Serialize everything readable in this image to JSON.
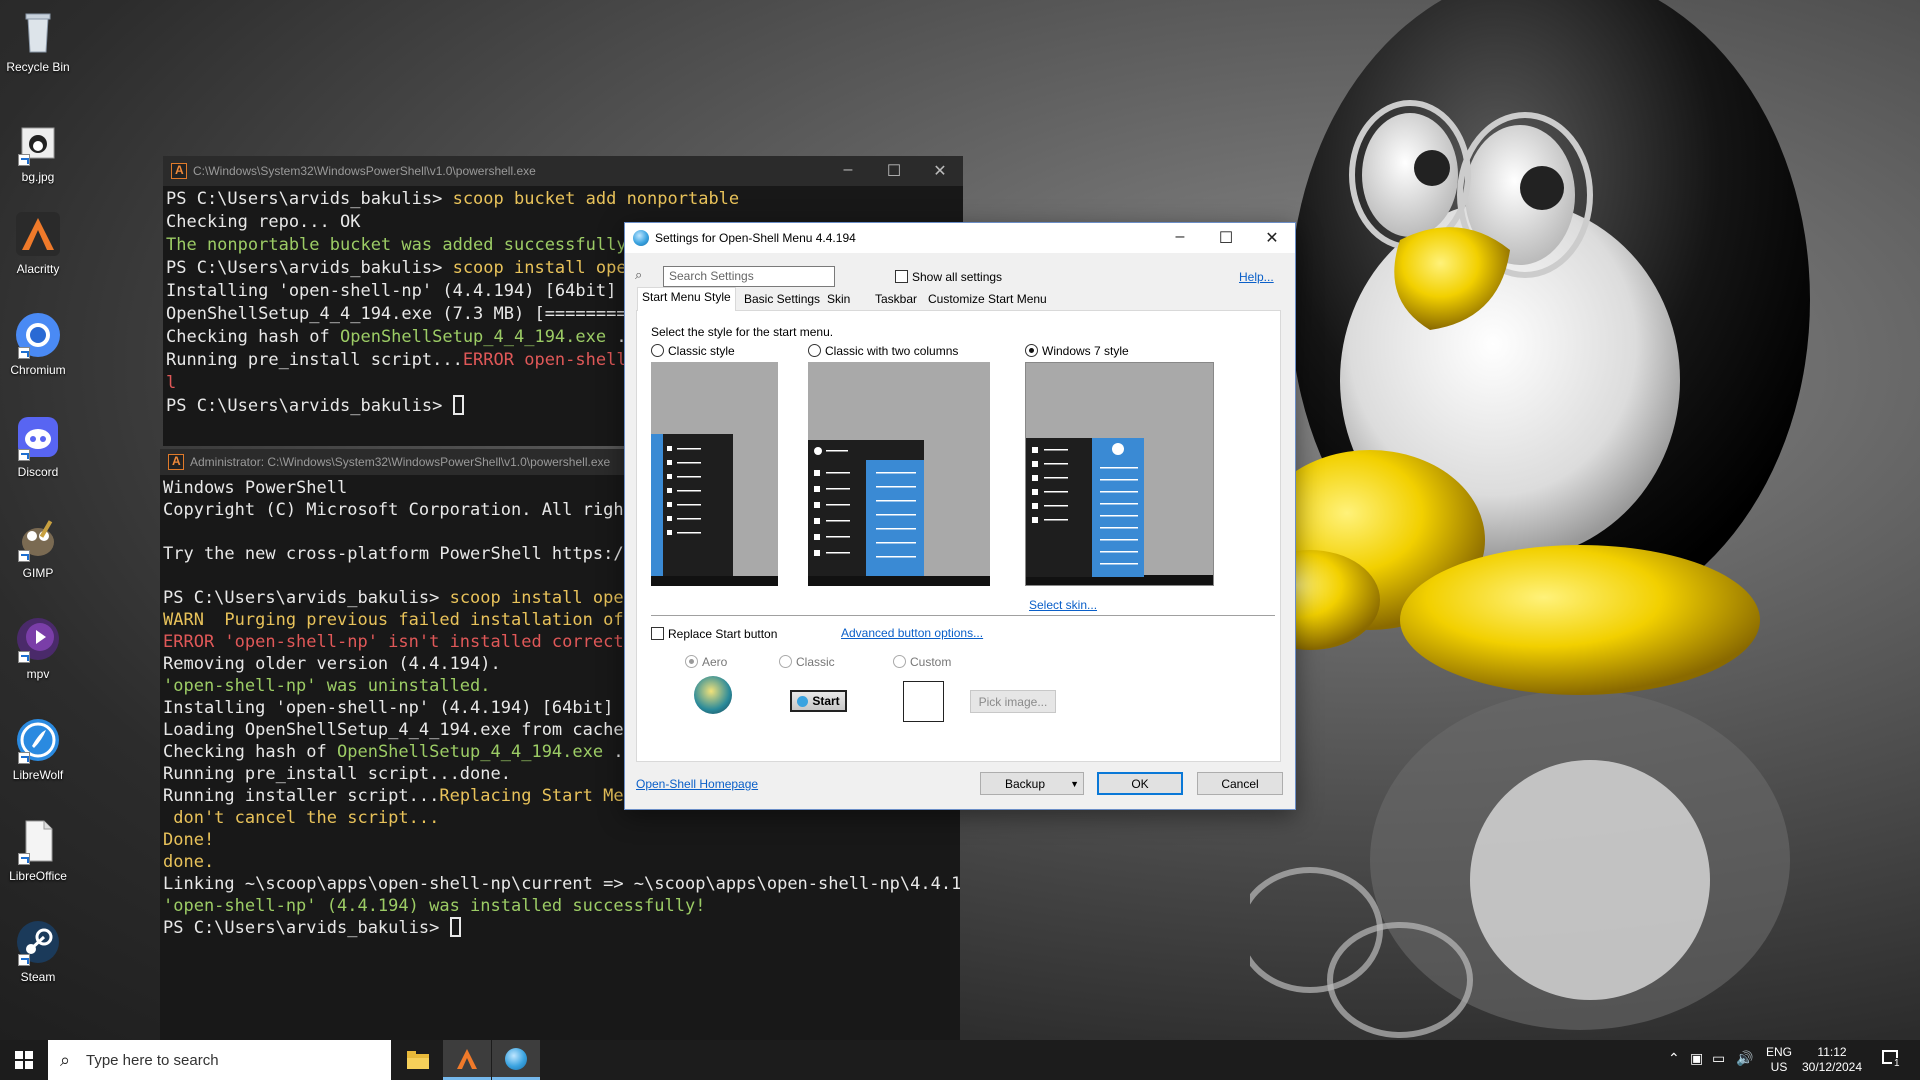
{
  "desktop": {
    "icons": [
      {
        "label": "Recycle Bin",
        "icon": "recycle-bin-icon"
      },
      {
        "label": "bg.jpg",
        "icon": "image-file-icon"
      },
      {
        "label": "Alacritty",
        "icon": "alacritty-icon"
      },
      {
        "label": "Chromium",
        "icon": "chromium-icon"
      },
      {
        "label": "Discord",
        "icon": "discord-icon"
      },
      {
        "label": "GIMP",
        "icon": "gimp-icon"
      },
      {
        "label": "mpv",
        "icon": "mpv-icon"
      },
      {
        "label": "LibreWolf",
        "icon": "librewolf-icon"
      },
      {
        "label": "LibreOffice",
        "icon": "libreoffice-icon"
      },
      {
        "label": "Steam",
        "icon": "steam-icon"
      }
    ]
  },
  "terminal1": {
    "title": "C:\\Windows\\System32\\WindowsPowerShell\\v1.0\\powershell.exe",
    "lines": [
      "PS C:\\Users\\arvids_bakulis> ",
      "scoop bucket add nonportable",
      "Checking repo... OK",
      "The nonportable bucket was added successfully.",
      "PS C:\\Users\\arvids_bakulis> ",
      "scoop install open",
      "Installing 'open-shell-np' (4.4.194) [64bit] f",
      "OpenShellSetup_4_4_194.exe (7.3 MB) [=========",
      "Checking hash of ",
      "OpenShellSetup_4_4_194.exe",
      " ..",
      "Running pre_install script...",
      "ERROR open-shell-",
      "l",
      "PS C:\\Users\\arvids_bakulis> "
    ]
  },
  "terminal2": {
    "title": "Administrator: C:\\Windows\\System32\\WindowsPowerShell\\v1.0\\powershell.exe",
    "lines": [
      "Windows PowerShell",
      "Copyright (C) Microsoft Corporation. All rights",
      "",
      "Try the new cross-platform PowerShell https://a",
      "",
      "PS C:\\Users\\arvids_bakulis> ",
      "scoop install open-",
      "WARN  Purging previous failed installation of o",
      "ERROR 'open-shell-np' isn't installed correctly",
      "Removing older version (4.4.194).",
      "'open-shell-np' was uninstalled.",
      "Installing 'open-shell-np' (4.4.194) [64bit] fr",
      "Loading OpenShellSetup_4_4_194.exe from cache",
      "Checking hash of ",
      "OpenShellSetup_4_4_194.exe",
      " ..",
      "Running pre_install script...done.",
      "Running installer script...",
      "Replacing Start Menu",
      " don't cancel the script...",
      "Done!",
      "done.",
      "Linking ~\\scoop\\apps\\open-shell-np\\current => ~\\scoop\\apps\\open-shell-np\\4.4.194",
      "'open-shell-np' (4.4.194) was installed successfully!",
      "PS C:\\Users\\arvids_bakulis> "
    ]
  },
  "dialog": {
    "title": "Settings for Open-Shell Menu 4.4.194",
    "search_placeholder": "Search Settings",
    "show_all": "Show all settings",
    "help": "Help...",
    "tabs": [
      "Start Menu Style",
      "Basic Settings",
      "Skin",
      "Taskbar",
      "Customize Start Menu"
    ],
    "prompt": "Select the style for the start menu.",
    "styles": [
      "Classic style",
      "Classic with two columns",
      "Windows 7 style"
    ],
    "selected_style": "Windows 7 style",
    "select_skin": "Select skin...",
    "replace_start": "Replace Start button",
    "advanced": "Advanced button options...",
    "button_styles": [
      "Aero",
      "Classic",
      "Custom"
    ],
    "start_label": "Start",
    "pick_image": "Pick image...",
    "homepage": "Open-Shell Homepage",
    "backup": "Backup",
    "ok": "OK",
    "cancel": "Cancel"
  },
  "taskbar": {
    "search_text": "Type here to search",
    "lang": "ENG",
    "region": "US",
    "time": "11:12",
    "date": "30/12/2024",
    "notifications": "1"
  }
}
